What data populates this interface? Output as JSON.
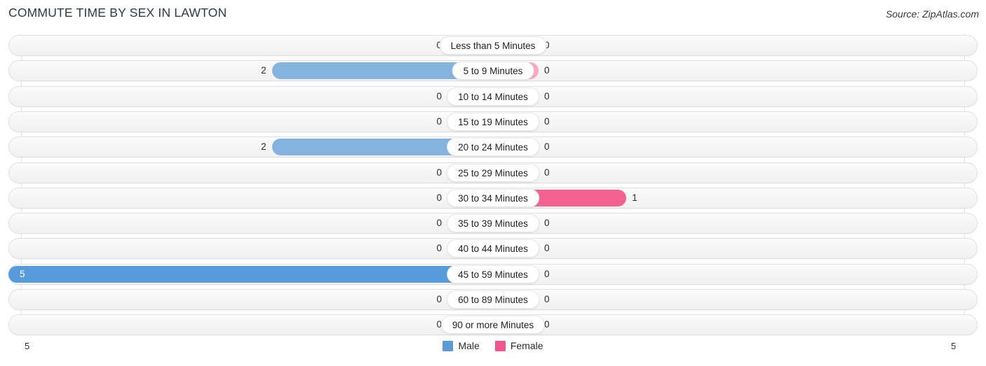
{
  "header": {
    "title": "COMMUTE TIME BY SEX IN LAWTON",
    "source": "Source: ZipAtlas.com"
  },
  "legend": {
    "male_label": "Male",
    "female_label": "Female",
    "male_color": "#5b9bd5",
    "female_color": "#f2568f"
  },
  "axis": {
    "left_label": "5",
    "right_label": "5",
    "max": 5
  },
  "colors": {
    "male_zero": "#aecbeb",
    "male_mid": "#85b3e0",
    "male_high": "#589bdb",
    "female_zero": "#f9a8c4",
    "female_value": "#f4638f"
  },
  "chart_data": {
    "type": "bar",
    "title": "COMMUTE TIME BY SEX IN LAWTON",
    "xlabel": "",
    "ylabel": "",
    "orientation": "horizontal-diverging",
    "xlim": [
      5,
      5
    ],
    "grid": true,
    "legend_position": "bottom-center",
    "categories": [
      "Less than 5 Minutes",
      "5 to 9 Minutes",
      "10 to 14 Minutes",
      "15 to 19 Minutes",
      "20 to 24 Minutes",
      "25 to 29 Minutes",
      "30 to 34 Minutes",
      "35 to 39 Minutes",
      "40 to 44 Minutes",
      "45 to 59 Minutes",
      "60 to 89 Minutes",
      "90 or more Minutes"
    ],
    "series": [
      {
        "name": "Male",
        "values": [
          0,
          2,
          0,
          0,
          2,
          0,
          0,
          0,
          0,
          5,
          0,
          0
        ]
      },
      {
        "name": "Female",
        "values": [
          0,
          0,
          0,
          0,
          0,
          0,
          1,
          0,
          0,
          0,
          0,
          0
        ]
      }
    ]
  },
  "rows": [
    {
      "label": "Less than 5 Minutes",
      "male": "0",
      "female": "0"
    },
    {
      "label": "5 to 9 Minutes",
      "male": "2",
      "female": "0"
    },
    {
      "label": "10 to 14 Minutes",
      "male": "0",
      "female": "0"
    },
    {
      "label": "15 to 19 Minutes",
      "male": "0",
      "female": "0"
    },
    {
      "label": "20 to 24 Minutes",
      "male": "2",
      "female": "0"
    },
    {
      "label": "25 to 29 Minutes",
      "male": "0",
      "female": "0"
    },
    {
      "label": "30 to 34 Minutes",
      "male": "0",
      "female": "1"
    },
    {
      "label": "35 to 39 Minutes",
      "male": "0",
      "female": "0"
    },
    {
      "label": "40 to 44 Minutes",
      "male": "0",
      "female": "0"
    },
    {
      "label": "45 to 59 Minutes",
      "male": "5",
      "female": "0"
    },
    {
      "label": "60 to 89 Minutes",
      "male": "0",
      "female": "0"
    },
    {
      "label": "90 or more Minutes",
      "male": "0",
      "female": "0"
    }
  ]
}
